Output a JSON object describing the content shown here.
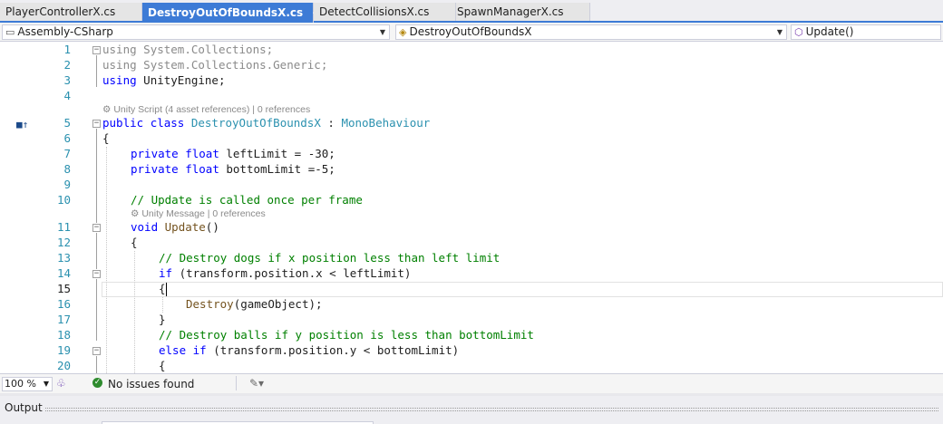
{
  "tabs": [
    {
      "label": "PlayerControllerX.cs",
      "active": false
    },
    {
      "label": "DestroyOutOfBoundsX.cs",
      "active": true,
      "pin": "⊣",
      "close": "✕"
    },
    {
      "label": "DetectCollisionsX.cs",
      "active": false
    },
    {
      "label": "SpawnManagerX.cs",
      "active": false
    }
  ],
  "nav": {
    "project": "Assembly-CSharp",
    "class": "DestroyOutOfBoundsX",
    "member": "Update()"
  },
  "code": {
    "line_numbers": [
      "1",
      "2",
      "3",
      "4",
      "5",
      "6",
      "7",
      "8",
      "9",
      "10",
      "11",
      "12",
      "13",
      "14",
      "15",
      "16",
      "17",
      "18",
      "19",
      "20"
    ],
    "lens_class": "Unity Script (4 asset references) | 0 references",
    "lens_method": "Unity Message | 0 references",
    "l1": {
      "kw": "using",
      "rest": " System.Collections;"
    },
    "l2": {
      "kw": "using",
      "rest": " System.Collections.Generic;"
    },
    "l3": {
      "kw": "using",
      "rest": " UnityEngine;"
    },
    "l5": {
      "kw1": "public",
      "kw2": "class",
      "name": "DestroyOutOfBoundsX",
      "colon": " : ",
      "base": "MonoBehaviour"
    },
    "l6": "{",
    "l7": {
      "kw1": "private",
      "kw2": "float",
      "rest": " leftLimit = -30;"
    },
    "l8": {
      "kw1": "private",
      "kw2": "float",
      "rest": " bottomLimit =-5;"
    },
    "l10": "// Update is called once per frame",
    "l11": {
      "kw": "void",
      "name": "Update",
      "rest": "()"
    },
    "l12": "{",
    "l13": "// Destroy dogs if x position less than left limit",
    "l14": {
      "kw": "if",
      "rest": " (transform.position.x < leftLimit)"
    },
    "l15": "{",
    "l16": {
      "name": "Destroy",
      "rest": "(gameObject);"
    },
    "l17": "}",
    "l18": "// Destroy balls if y position is less than bottomLimit",
    "l19": {
      "kw1": "else",
      "kw2": "if",
      "rest": " (transform.position.y < bottomLimit)"
    },
    "l20": "{"
  },
  "status": {
    "zoom": "100 %",
    "issues": "No issues found"
  },
  "output": {
    "title": "Output"
  },
  "colors": {
    "accent": "#3d7bd6",
    "keyword": "#0000ff",
    "type": "#2b91af",
    "comment": "#008000",
    "ok": "#2e8b2e"
  }
}
